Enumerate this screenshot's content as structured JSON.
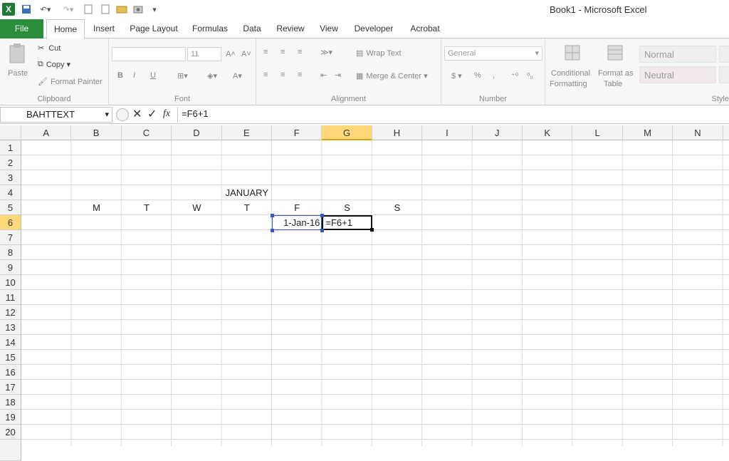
{
  "window": {
    "title": "Book1  -  Microsoft Excel"
  },
  "tabs": [
    {
      "label": "File"
    },
    {
      "label": "Home"
    },
    {
      "label": "Insert"
    },
    {
      "label": "Page Layout"
    },
    {
      "label": "Formulas"
    },
    {
      "label": "Data"
    },
    {
      "label": "Review"
    },
    {
      "label": "View"
    },
    {
      "label": "Developer"
    },
    {
      "label": "Acrobat"
    }
  ],
  "ribbon": {
    "clipboard": {
      "paste": "Paste",
      "cut": "Cut",
      "copy": "Copy",
      "format_painter": "Format Painter",
      "label": "Clipboard"
    },
    "font": {
      "size": "11",
      "bold": "B",
      "italic": "I",
      "underline": "U",
      "label": "Font"
    },
    "alignment": {
      "wrap_text": "Wrap Text",
      "merge_center": "Merge & Center",
      "label": "Alignment"
    },
    "number": {
      "format": "General",
      "label": "Number"
    },
    "styles": {
      "conditional_1": "Conditional",
      "conditional_2": "Formatting",
      "format_table_1": "Format as",
      "format_table_2": "Table",
      "normal": "Normal",
      "neutral": "Neutral",
      "label": "Style"
    }
  },
  "formula_bar": {
    "name_box": "BAHTTEXT",
    "formula": "=F6+1"
  },
  "columns": [
    "A",
    "B",
    "C",
    "D",
    "E",
    "F",
    "G",
    "H",
    "I",
    "J",
    "K",
    "L",
    "M",
    "N"
  ],
  "rows": [
    "1",
    "2",
    "3",
    "4",
    "5",
    "6",
    "7",
    "8",
    "9",
    "10",
    "11",
    "12",
    "13",
    "14",
    "15",
    "16",
    "17",
    "18",
    "19",
    "20"
  ],
  "cells": {
    "E4": "JANUARY",
    "B5": "M",
    "C5": "T",
    "D5": "W",
    "E5": "T",
    "F5": "F",
    "G5": "S",
    "H5": "S",
    "F6": "1-Jan-16",
    "G6": "=F6+1"
  },
  "colors": {
    "file_tab": "#2a8d3c",
    "selection_header": "#ffd87a"
  }
}
